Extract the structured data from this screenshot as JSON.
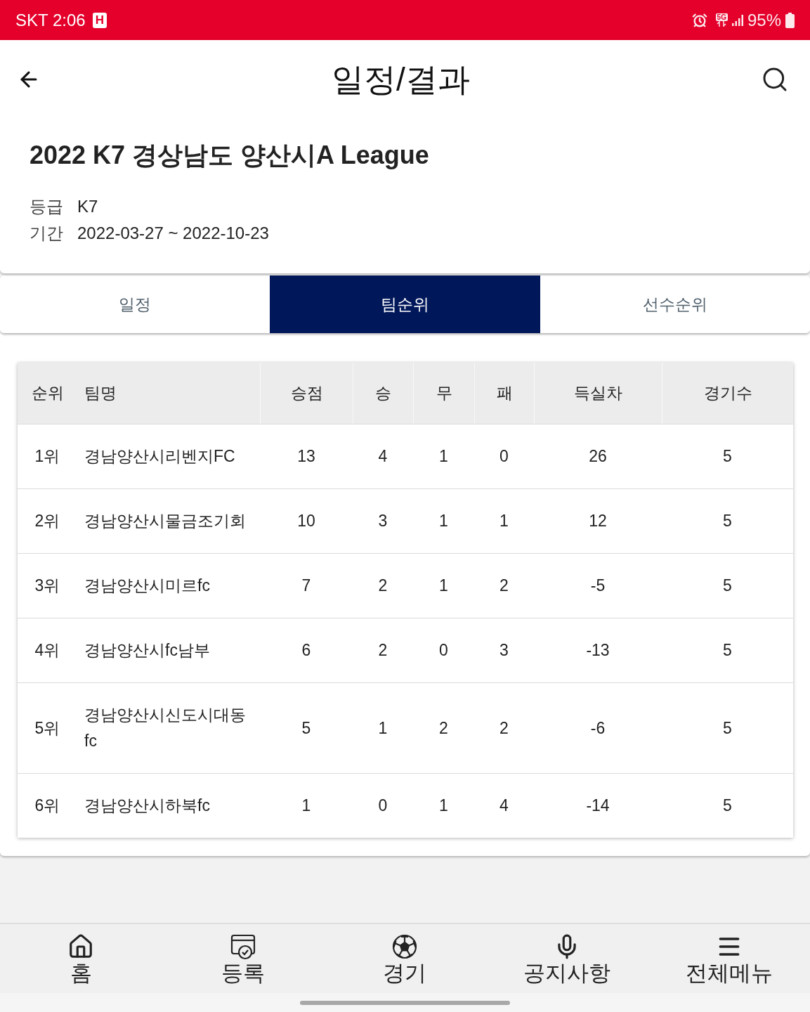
{
  "status_bar": {
    "carrier_time": "SKT 2:06",
    "badge": "H",
    "network": "5G",
    "battery": "95%"
  },
  "header": {
    "title": "일정/결과"
  },
  "league": {
    "title": "2022 K7 경상남도 양산시A League",
    "details": [
      {
        "label": "등급",
        "value": "K7"
      },
      {
        "label": "기간",
        "value": "2022-03-27 ~ 2022-10-23"
      }
    ]
  },
  "tabs": [
    {
      "label": "일정",
      "selected": false
    },
    {
      "label": "팀순위",
      "selected": true
    },
    {
      "label": "선수순위",
      "selected": false
    }
  ],
  "standings": {
    "columns": [
      "순위",
      "팀명",
      "승점",
      "승",
      "무",
      "패",
      "득실차",
      "경기수"
    ],
    "rows": [
      [
        "1위",
        "경남양산시리벤지FC",
        "13",
        "4",
        "1",
        "0",
        "26",
        "5"
      ],
      [
        "2위",
        "경남양산시물금조기회",
        "10",
        "3",
        "1",
        "1",
        "12",
        "5"
      ],
      [
        "3위",
        "경남양산시미르fc",
        "7",
        "2",
        "1",
        "2",
        "-5",
        "5"
      ],
      [
        "4위",
        "경남양산시fc남부",
        "6",
        "2",
        "0",
        "3",
        "-13",
        "5"
      ],
      [
        "5위",
        "경남양산시신도시대동fc",
        "5",
        "1",
        "2",
        "2",
        "-6",
        "5"
      ],
      [
        "6위",
        "경남양산시하북fc",
        "1",
        "0",
        "1",
        "4",
        "-14",
        "5"
      ]
    ]
  },
  "bottom_nav": [
    {
      "label": "홈"
    },
    {
      "label": "등록"
    },
    {
      "label": "경기"
    },
    {
      "label": "공지사항"
    },
    {
      "label": "전체메뉴"
    }
  ]
}
